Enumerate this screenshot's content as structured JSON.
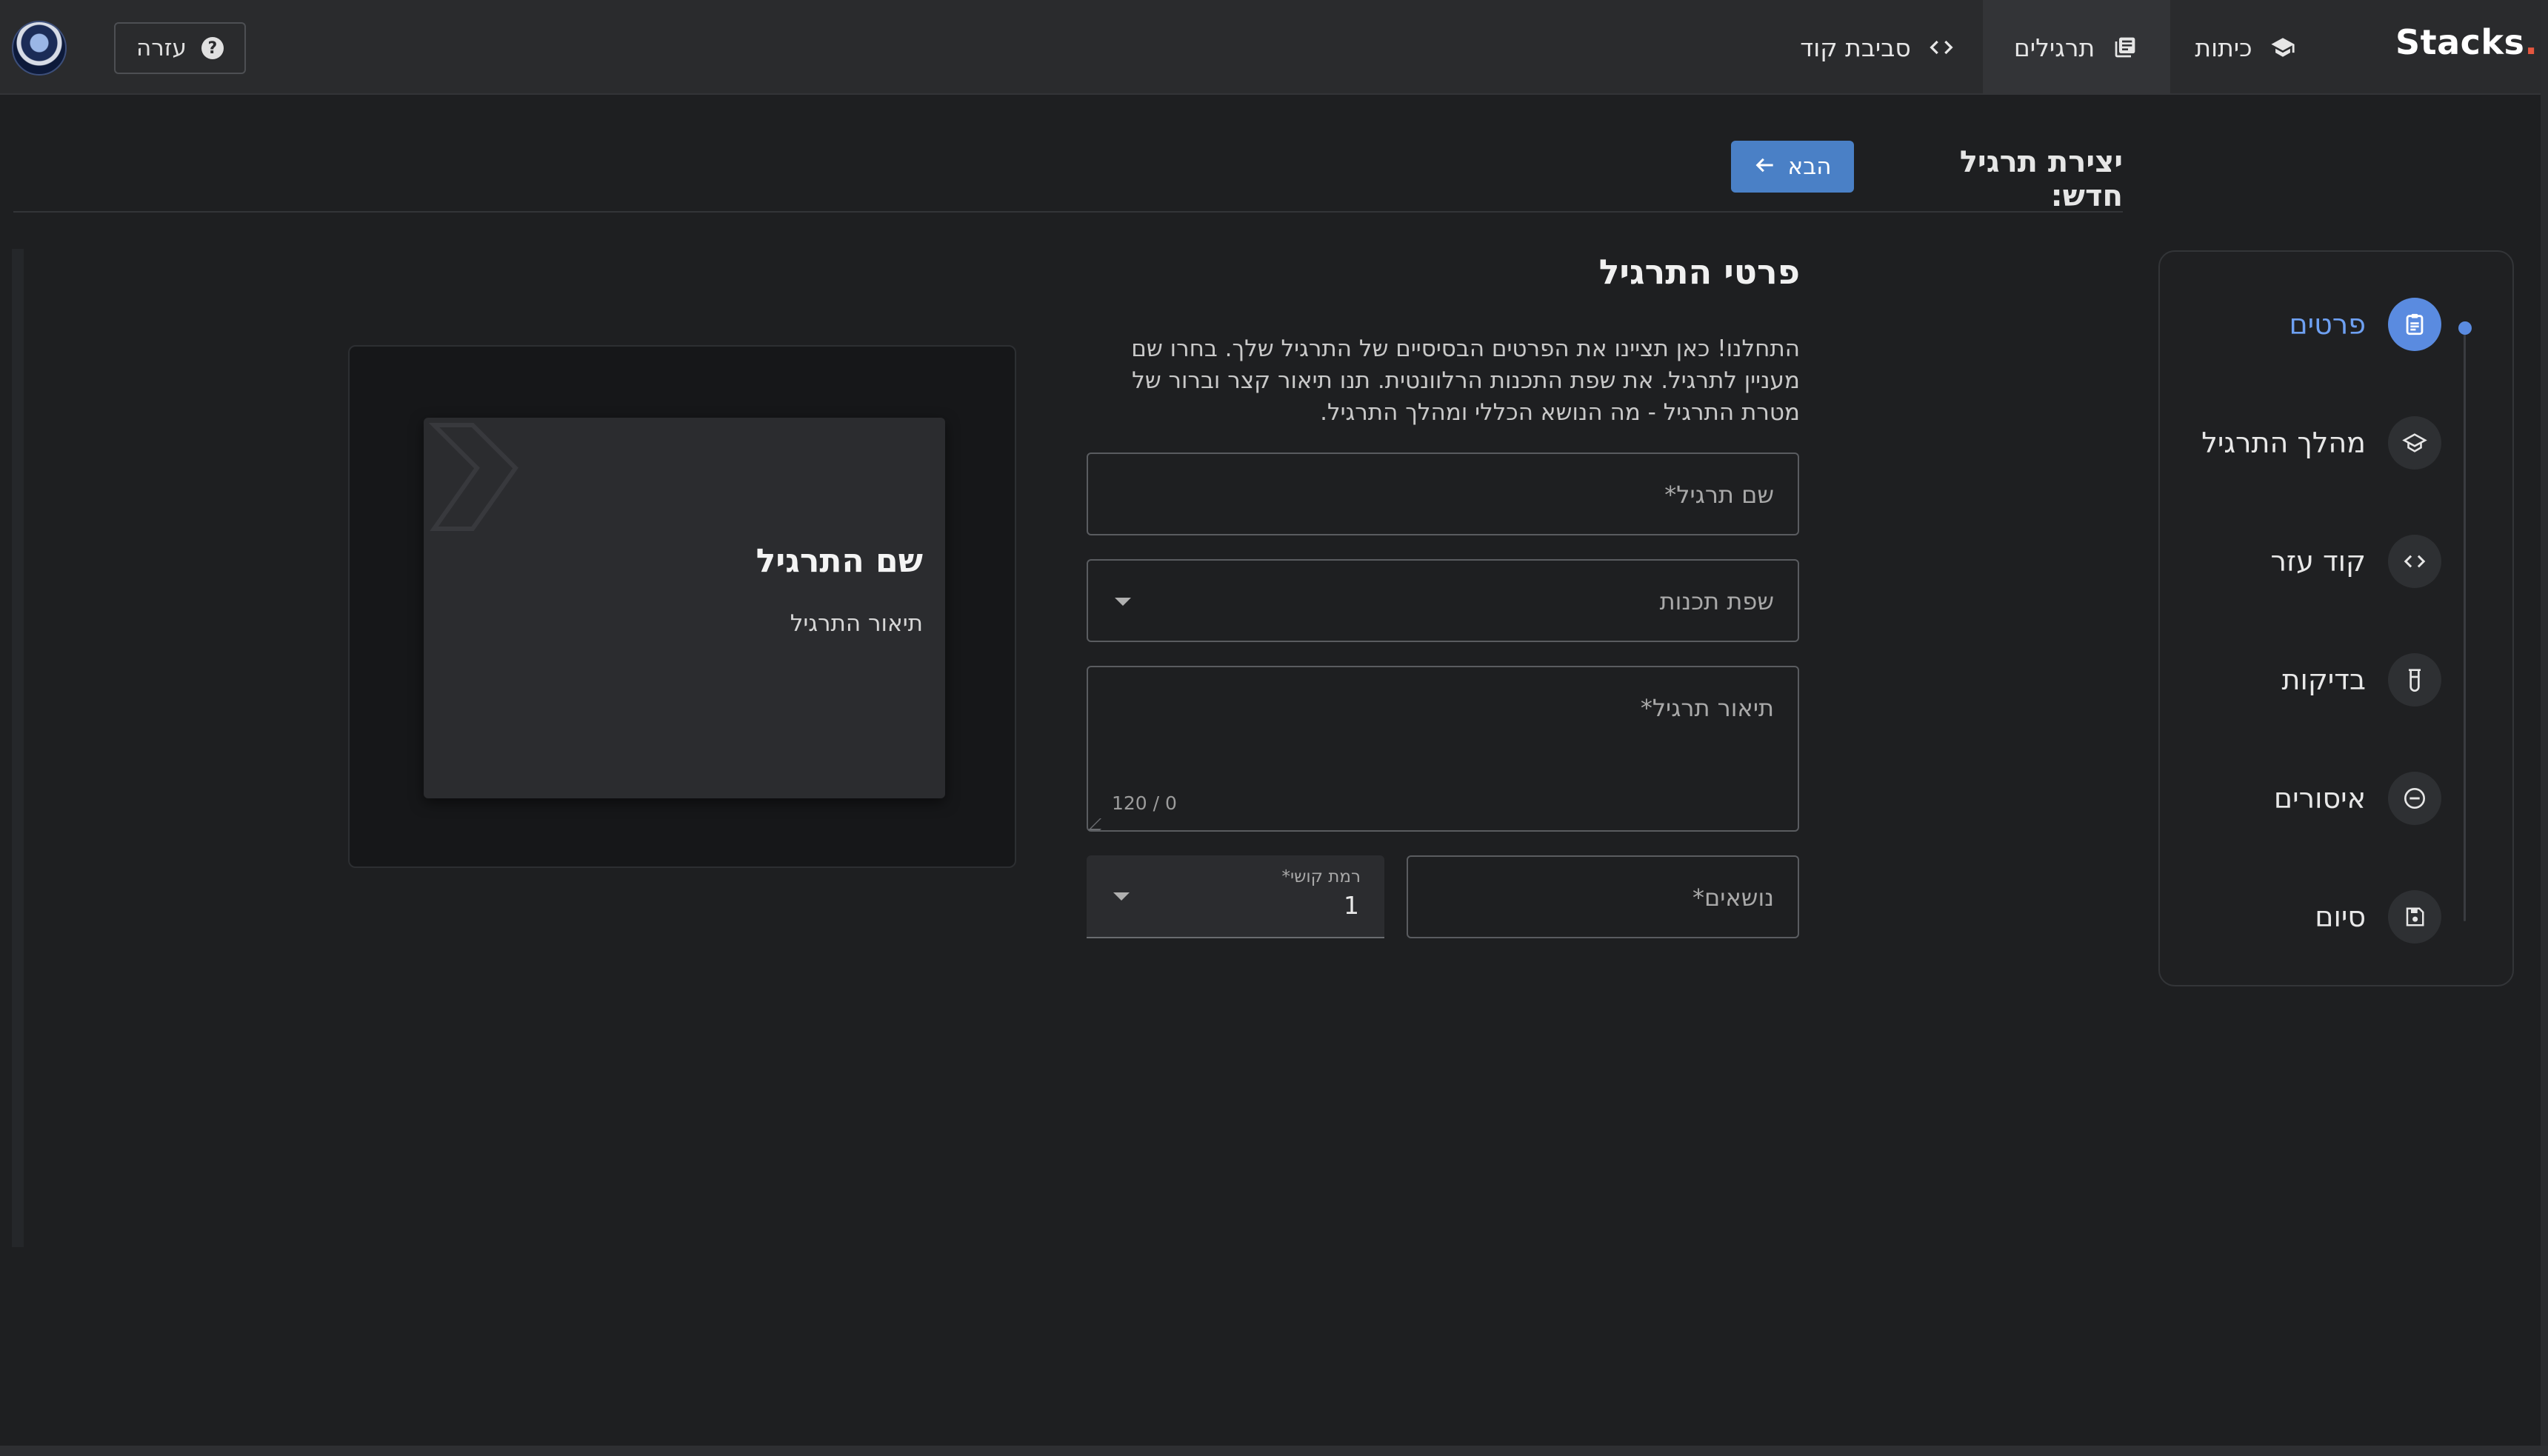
{
  "app": {
    "brand": "Stacks",
    "brand_dot": ".",
    "colors": {
      "accent": "#4a80c6",
      "active_step": "#5a8be0",
      "brand_dot": "#e5573f"
    }
  },
  "nav": {
    "classes": {
      "label": "כיתות",
      "icon": "graduation-cap-icon"
    },
    "exercises": {
      "label": "תרגילים",
      "icon": "library-books-icon"
    },
    "code_env": {
      "label": "סביבת קוד",
      "icon": "code-icon"
    },
    "help": {
      "label": "עזרה",
      "icon": "help-circle-icon"
    }
  },
  "header": {
    "title": "יצירת תרגיל חדש:",
    "next_button": "הבא"
  },
  "stepper": {
    "steps": [
      {
        "label": "פרטים",
        "icon": "clipboard-icon",
        "active": true
      },
      {
        "label": "מהלך התרגיל",
        "icon": "graduation-cap-icon",
        "active": false
      },
      {
        "label": "קוד עזר",
        "icon": "code-icon",
        "active": false
      },
      {
        "label": "בדיקות",
        "icon": "test-tube-icon",
        "active": false
      },
      {
        "label": "איסורים",
        "icon": "minus-circle-icon",
        "active": false
      },
      {
        "label": "סיום",
        "icon": "save-icon",
        "active": false
      }
    ]
  },
  "form": {
    "section_title": "פרטי התרגיל",
    "intro": "התחלנו! כאן תציינו את הפרטים הבסיסיים של התרגיל שלך. בחרו שם מעניין לתרגיל. את שפת התכנות הרלוונטית. תנו תיאור קצר וברור של מטרת התרגיל - מה הנושא הכללי ומהלך התרגיל.",
    "name_placeholder": "שם תרגיל*",
    "language_placeholder": "שפת תכנות",
    "description_placeholder": "תיאור תרגיל*",
    "description_counter": "120 / 0",
    "topics_placeholder": "נושאים*",
    "difficulty_label": "רמת קושי*",
    "difficulty_value": "1"
  },
  "preview": {
    "title": "שם התרגיל",
    "description": "תיאור התרגיל"
  }
}
